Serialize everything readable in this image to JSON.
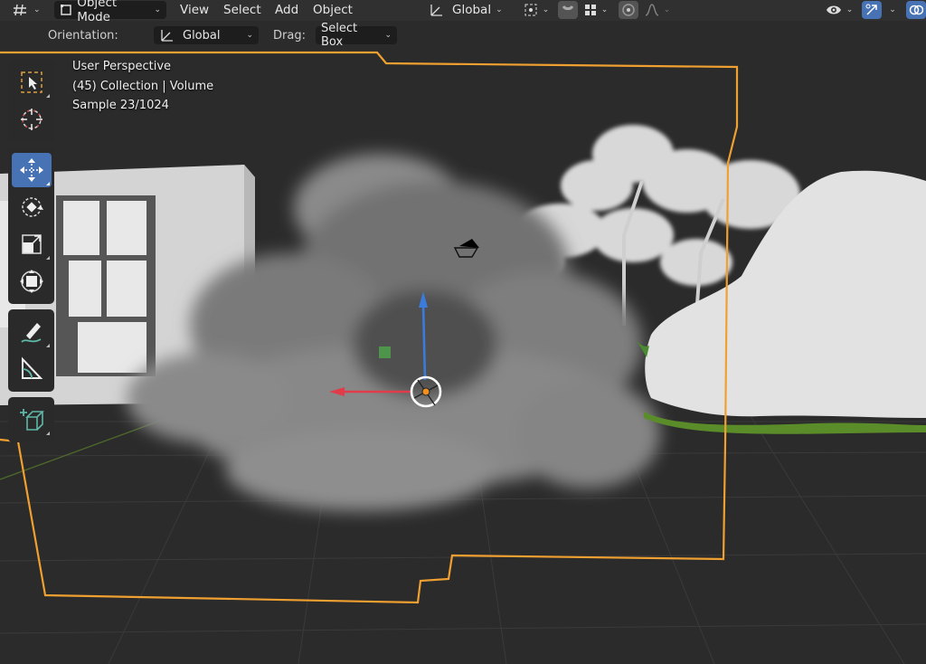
{
  "header": {
    "mode": "Object Mode",
    "menus": [
      "View",
      "Select",
      "Add",
      "Object"
    ],
    "transform_orientation": "Global"
  },
  "tool_settings": {
    "orientation_label": "Orientation:",
    "orientation_value": "Global",
    "drag_label": "Drag:",
    "drag_value": "Select Box"
  },
  "viewport": {
    "perspective": "User Perspective",
    "collection": "(45) Collection | Volume",
    "sample": "Sample 23/1024"
  },
  "toolbar": {
    "tools": [
      "select-box",
      "cursor",
      "move",
      "rotate",
      "scale",
      "transform",
      "annotate",
      "measure",
      "add-cube"
    ],
    "active_tool": "move"
  },
  "colors": {
    "selection_outline": "#f0a030",
    "active_tool": "#4772b3",
    "x_axis": "#e03c4a",
    "z_axis": "#3a7bdc"
  }
}
